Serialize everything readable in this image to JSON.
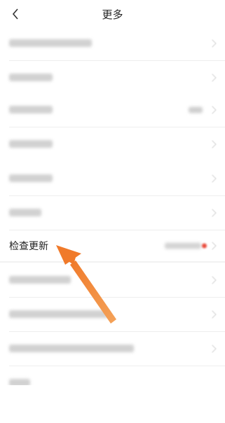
{
  "header": {
    "title": "更多",
    "back_icon": "chevron-left-icon"
  },
  "rows": {
    "check_update": {
      "label": "检查更新"
    }
  },
  "colors": {
    "accent_arrow": "#f08a3a",
    "badge_dot": "#e94b3c"
  }
}
